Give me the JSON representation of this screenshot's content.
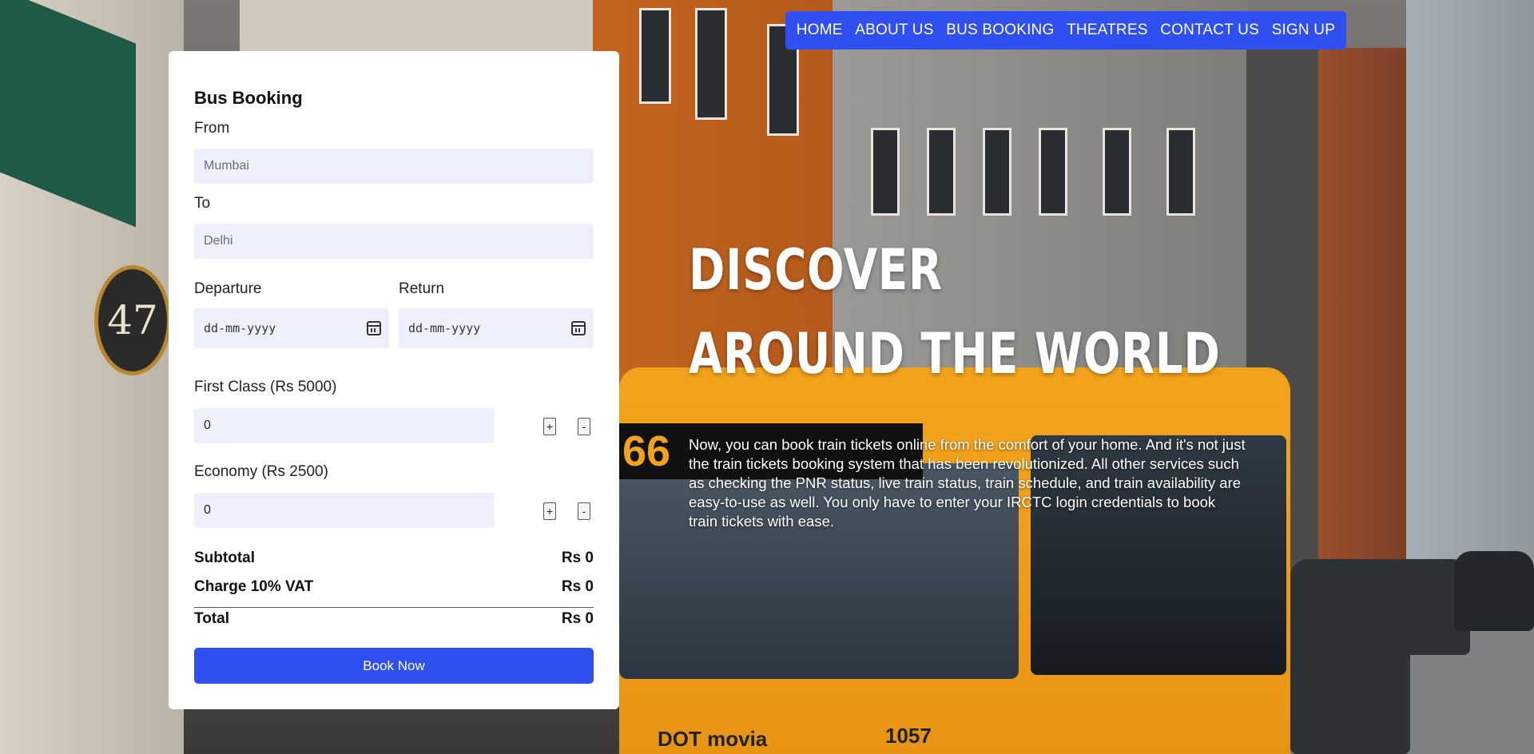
{
  "nav": {
    "items": [
      "HOME",
      "ABOUT US",
      "BUS BOOKING",
      "THEATRES",
      "CONTACT US",
      "SIGN UP"
    ],
    "accent_color": "#2f4ff0"
  },
  "booking": {
    "title": "Bus Booking",
    "from_label": "From",
    "from_placeholder": "Mumbai",
    "to_label": "To",
    "to_placeholder": "Delhi",
    "departure_label": "Departure",
    "departure_value": "dd-mm-yyyy",
    "return_label": "Return",
    "return_value": "dd-mm-yyyy",
    "calendar_icon": "calendar-icon",
    "first_class_label": "First Class (Rs 5000)",
    "first_class_qty": "0",
    "economy_label": "Economy (Rs 2500)",
    "economy_qty": "0",
    "plus": "+",
    "minus": "-",
    "subtotal_label": "Subtotal",
    "subtotal_value": "Rs 0",
    "vat_label": "Charge 10% VAT",
    "vat_value": "Rs 0",
    "total_label": "Total",
    "total_value": "Rs 0",
    "book_button": "Book Now"
  },
  "hero": {
    "line1": "DISCOVER",
    "line2": "AROUND THE WORLD",
    "description": "Now, you can book train tickets online from the comfort of your home. And it's not just the train tickets booking system that has been revolutionized. All other services such as checking the PNR status, live train status, train schedule, and train availability are easy-to-use as well. You only have to enter your IRCTC login credentials to book train tickets with ease."
  },
  "background": {
    "bus_sign_text": "66",
    "bus_number": "1057",
    "bus_brand": "DOT movia",
    "building_number": "47"
  }
}
